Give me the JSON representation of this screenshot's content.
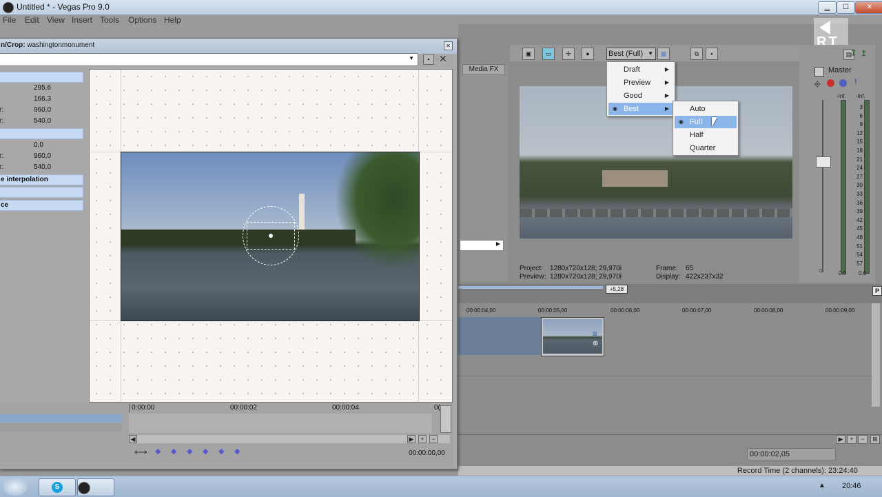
{
  "window": {
    "title": "Untitled * - Vegas Pro 9.0",
    "min": "▁",
    "max": "☐",
    "close": "✕"
  },
  "menubar": [
    "File",
    "Edit",
    "View",
    "Insert",
    "Tools",
    "Options",
    "Help"
  ],
  "dialog": {
    "header_label": "n/Crop:",
    "header_value": "washingtonmonument",
    "close_small": "✕",
    "save": "💾",
    "delete": "✕",
    "props": [
      {
        "k": "",
        "v": "295,6"
      },
      {
        "k": "",
        "v": "166,3"
      },
      {
        "k": "r:",
        "v": "960,0"
      },
      {
        "k": "r:",
        "v": "540,0"
      },
      {
        "k": "",
        "v": "0,0"
      },
      {
        "k": "r:",
        "v": "960,0"
      },
      {
        "k": "r:",
        "v": "540,0"
      }
    ],
    "sections": [
      "e interpolation",
      "ce"
    ],
    "timeline": {
      "ticks": [
        "0:00:00",
        "00:00:02",
        "00:00:04",
        "0("
      ],
      "time": "00:00:00,00"
    },
    "kf_buttons": [
      "⟷",
      "◆",
      "◆",
      "◆",
      "◆",
      "◆",
      "◆"
    ]
  },
  "right": {
    "media_fx_tab": "Media FX",
    "quality_button": "Best (Full)",
    "quality_menu": [
      {
        "label": "Draft",
        "selected": false,
        "checked": false
      },
      {
        "label": "Preview",
        "selected": false,
        "checked": false
      },
      {
        "label": "Good",
        "selected": false,
        "checked": false
      },
      {
        "label": "Best",
        "selected": true,
        "checked": true
      }
    ],
    "res_menu": [
      {
        "label": "Auto",
        "selected": false,
        "checked": false
      },
      {
        "label": "Full",
        "selected": true,
        "checked": true
      },
      {
        "label": "Half",
        "selected": false,
        "checked": false
      },
      {
        "label": "Quarter",
        "selected": false,
        "checked": false
      }
    ],
    "preview_info": {
      "project_label": "Project:",
      "project": "1280x720x128; 29,970i",
      "preview_label": "Preview:",
      "preview": "1280x720x128; 29,970i",
      "frame_label": "Frame:",
      "frame": "65",
      "display_label": "Display:",
      "display": "422x237x32"
    },
    "master": {
      "label": "Master",
      "inf1": "-Inf.",
      "inf2": "-Inf.",
      "zero1": "0.0",
      "zero2": "0.0",
      "scale": [
        "3",
        "6",
        "9",
        "12",
        "15",
        "18",
        "21",
        "24",
        "27",
        "30",
        "33",
        "36",
        "39",
        "42",
        "45",
        "48",
        "51",
        "54",
        "57"
      ]
    },
    "timeline": {
      "marker": "+5,28",
      "ticks": [
        "00:00:04,00",
        "00:00:05,00",
        "00:00:06,00",
        "00:00:07,00",
        "00:00:08,00",
        "00:00:09,00"
      ],
      "time": "00:00:02,05"
    },
    "status": "Record Time (2 channels): 23:24:40",
    "watermark": "RT"
  },
  "taskbar": {
    "clock": "20:46"
  },
  "colors": {
    "selection": "#8cb6ea",
    "menu_bg": "#f2f2f2"
  }
}
